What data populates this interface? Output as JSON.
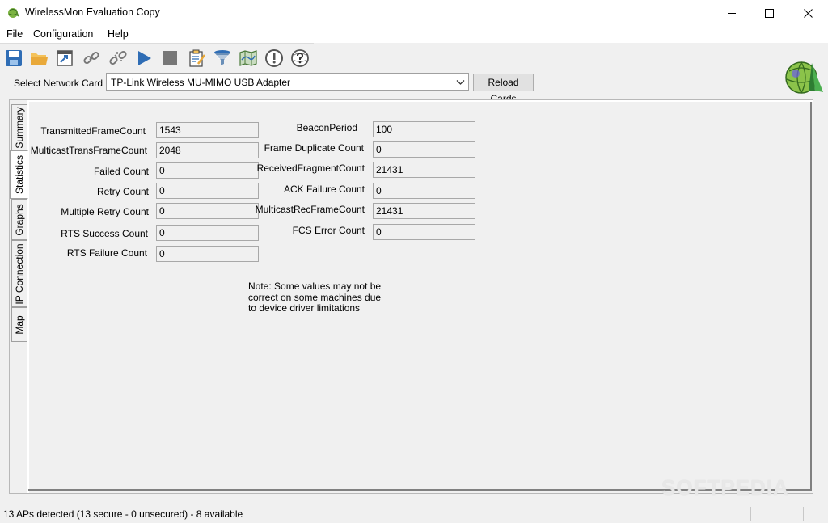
{
  "window": {
    "title": "WirelessMon Evaluation Copy"
  },
  "menu": [
    "File",
    "Configuration",
    "Help"
  ],
  "toolbar": [
    {
      "name": "save-icon"
    },
    {
      "name": "open-folder-icon"
    },
    {
      "name": "window-icon"
    },
    {
      "name": "connect-link-icon"
    },
    {
      "name": "disconnect-link-icon"
    },
    {
      "name": "play-icon"
    },
    {
      "name": "stop-icon"
    },
    {
      "name": "notes-icon"
    },
    {
      "name": "filter-icon"
    },
    {
      "name": "map-icon"
    },
    {
      "name": "alert-icon"
    },
    {
      "name": "help-globe-icon"
    }
  ],
  "network": {
    "label": "Select Network Card",
    "selected": "TP-Link Wireless MU-MIMO USB Adapter",
    "reload_label": "Reload Cards"
  },
  "tabs": [
    "Summary",
    "Statistics",
    "Graphs",
    "IP Connection",
    "Map"
  ],
  "active_tab": "Statistics",
  "stats_left": [
    {
      "label": "TransmittedFrameCount",
      "value": "1543"
    },
    {
      "label": "MulticastTransFrameCount",
      "value": "2048"
    },
    {
      "label": "Failed Count",
      "value": "0"
    },
    {
      "label": "Retry Count",
      "value": "0"
    },
    {
      "label": "Multiple Retry Count",
      "value": "0"
    },
    {
      "label": "RTS Success Count",
      "value": "0"
    },
    {
      "label": "RTS Failure Count",
      "value": "0"
    }
  ],
  "stats_right": [
    {
      "label": "BeaconPeriod",
      "value": "100"
    },
    {
      "label": "Frame Duplicate Count",
      "value": "0"
    },
    {
      "label": "ReceivedFragmentCount",
      "value": "21431"
    },
    {
      "label": "ACK Failure Count",
      "value": "0"
    },
    {
      "label": "MulticastRecFrameCount",
      "value": "21431"
    },
    {
      "label": "FCS Error Count",
      "value": "0"
    }
  ],
  "note": "Note: Some values may not be correct on some machines due to device driver limitations",
  "watermark": "SOFTPEDIA",
  "status": {
    "text": "13 APs detected (13 secure - 0 unsecured) - 8 available"
  }
}
